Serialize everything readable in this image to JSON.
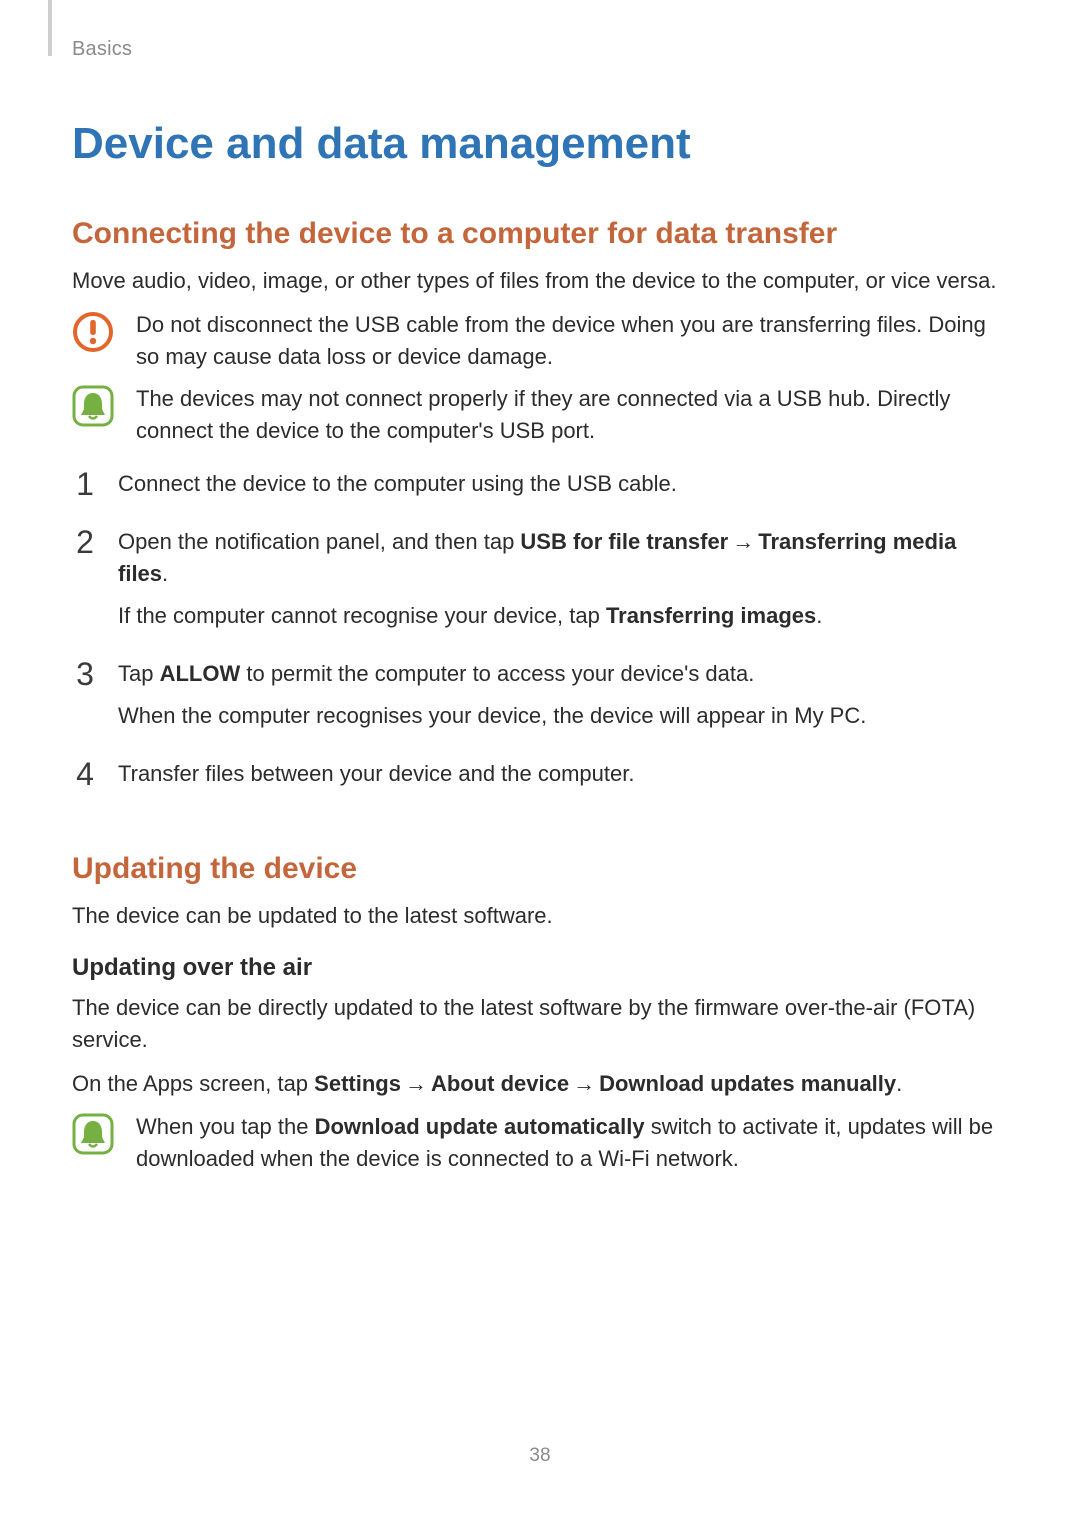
{
  "breadcrumb": "Basics",
  "title": "Device and data management",
  "section1": {
    "heading": "Connecting the device to a computer for data transfer",
    "intro": "Move audio, video, image, or other types of files from the device to the computer, or vice versa.",
    "warn": "Do not disconnect the USB cable from the device when you are transferring files. Doing so may cause data loss or device damage.",
    "note": "The devices may not connect properly if they are connected via a USB hub. Directly connect the device to the computer's USB port."
  },
  "steps": {
    "n1": "1",
    "s1": "Connect the device to the computer using the USB cable.",
    "n2": "2",
    "s2_pre": "Open the notification panel, and then tap ",
    "s2_b1": "USB for file transfer",
    "s2_arrow": "→",
    "s2_b2": "Transferring media files",
    "s2_post": ".",
    "s2_sub_pre": "If the computer cannot recognise your device, tap ",
    "s2_sub_b": "Transferring images",
    "s2_sub_post": ".",
    "n3": "3",
    "s3_pre": "Tap ",
    "s3_b": "ALLOW",
    "s3_post": " to permit the computer to access your device's data.",
    "s3_sub": "When the computer recognises your device, the device will appear in My PC.",
    "n4": "4",
    "s4": "Transfer files between your device and the computer."
  },
  "section2": {
    "heading": "Updating the device",
    "intro": "The device can be updated to the latest software.",
    "subhead": "Updating over the air",
    "p1": "The device can be directly updated to the latest software by the firmware over-the-air (FOTA) service.",
    "p2_pre": "On the Apps screen, tap ",
    "p2_b1": "Settings",
    "p2_arrow": "→",
    "p2_b2": "About device",
    "p2_b3": "Download updates manually",
    "p2_post": ".",
    "note_pre": "When you tap the ",
    "note_b": "Download update automatically",
    "note_post": " switch to activate it, updates will be downloaded when the device is connected to a Wi-Fi network."
  },
  "page_number": "38"
}
